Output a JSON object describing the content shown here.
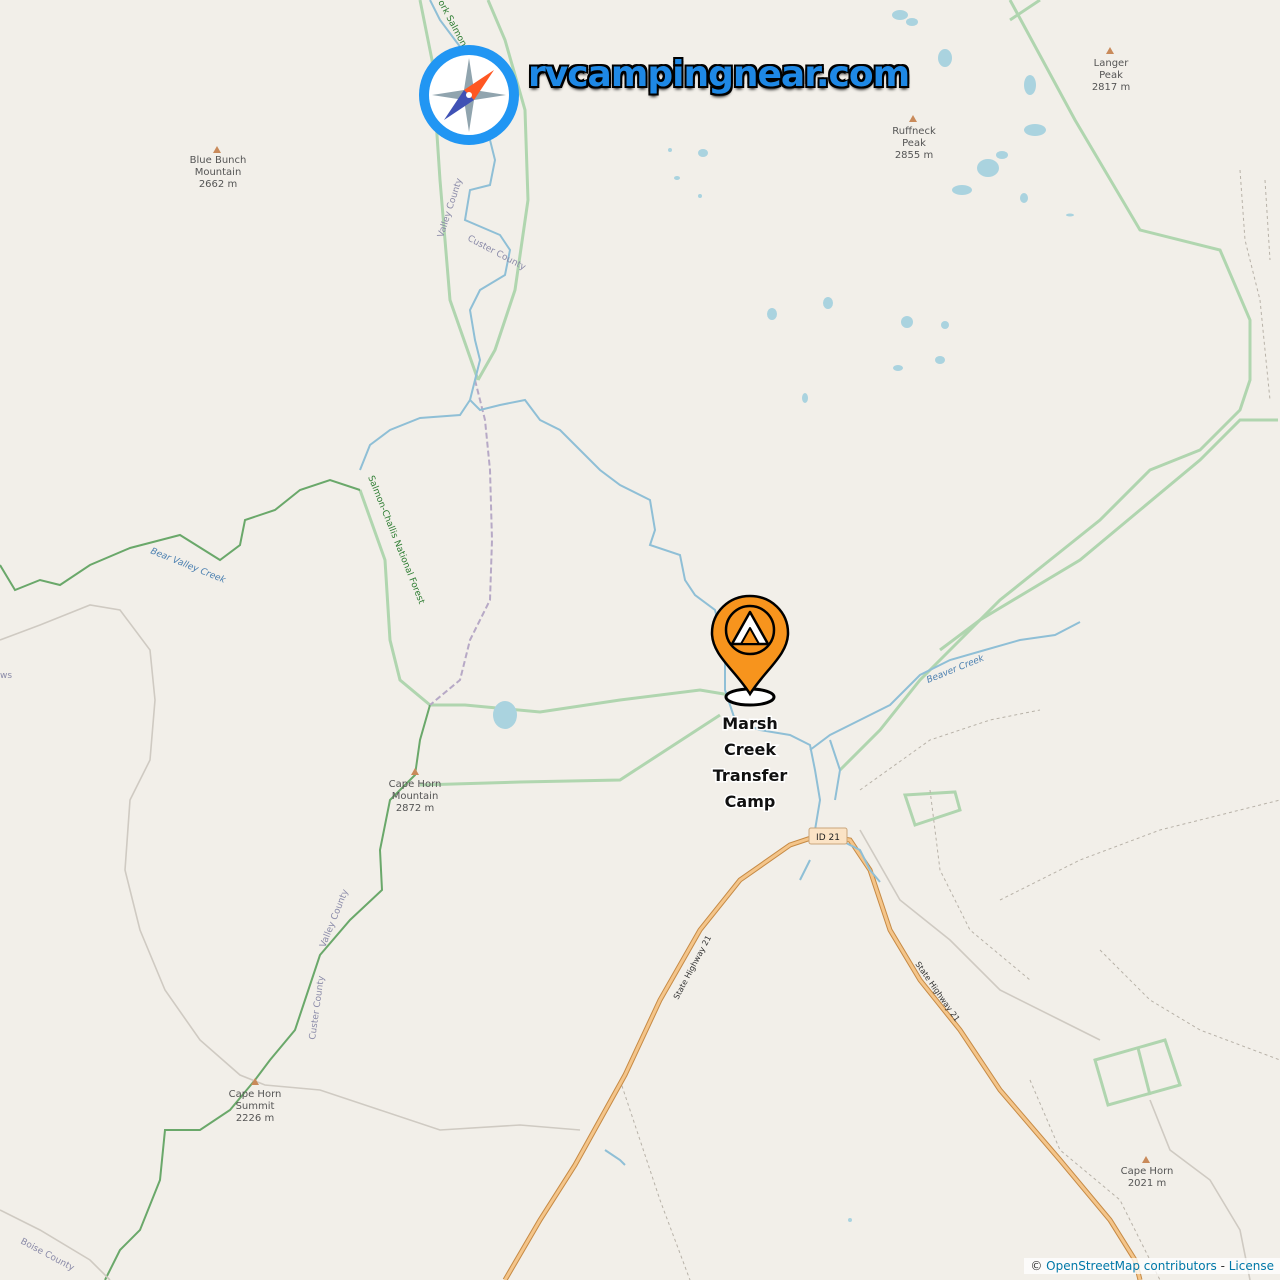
{
  "brand": {
    "name": "rvcampingnear.com",
    "accent_color": "#1e88e5",
    "compass_icon": "compass-icon"
  },
  "marker": {
    "label_lines": [
      "Marsh",
      "Creek",
      "Transfer",
      "Camp"
    ],
    "icon": "camp-tent-icon",
    "color": "#f7941d"
  },
  "peaks": [
    {
      "name": "Blue Bunch",
      "name2": "Mountain",
      "elevation": "2662 m"
    },
    {
      "name": "Langer",
      "name2": "Peak",
      "elevation": "2817 m"
    },
    {
      "name": "Ruffneck",
      "name2": "Peak",
      "elevation": "2855 m"
    },
    {
      "name": "Cape Horn",
      "name2": "Mountain",
      "elevation": "2872 m"
    },
    {
      "name": "Cape Horn",
      "name2": "Summit",
      "elevation": "2226 m"
    },
    {
      "name": "Cape Horn",
      "name2": "",
      "elevation": "2021 m"
    }
  ],
  "labels": {
    "valley_county_1": "Valley County",
    "custer_county_1": "Custer County",
    "valley_county_2": "Valley County",
    "custer_county_2": "Custer County",
    "boise_county": "Boise County",
    "bear_valley_creek": "Bear Valley Creek",
    "beaver_creek": "Beaver Creek",
    "forest": "Salmon-Challis National Forest",
    "salmon_river": "ork Salmon",
    "highway_left": "State Highway 21",
    "highway_right": "State Highway 21",
    "shield": "ID 21",
    "edge_ws": "ws"
  },
  "attribution": {
    "prefix": "©",
    "osm": "OpenStreetMap contributors",
    "separator": " - ",
    "license": "License"
  },
  "colors": {
    "background": "#f2efe9",
    "water": "#aad3df",
    "boundary": "#9ccb9c",
    "forest_boundary": "#5a9e5a",
    "highway": "#f2b36b"
  }
}
